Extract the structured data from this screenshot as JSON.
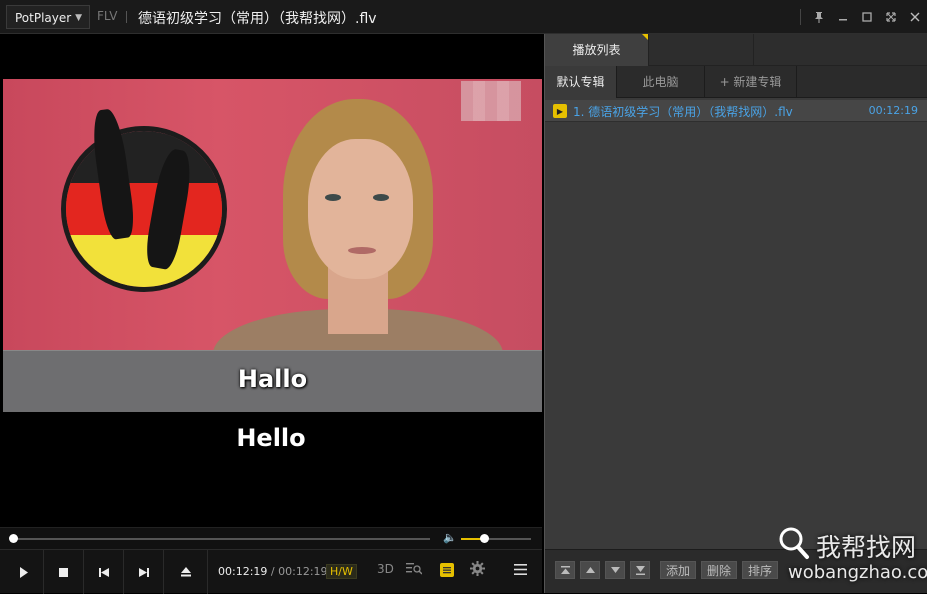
{
  "titlebar": {
    "app_name": "PotPlayer",
    "format": "FLV",
    "file_title": "德语初级学习（常用）（我帮找网）.flv"
  },
  "video": {
    "subtitle_primary": "Hallo",
    "subtitle_secondary": "Hello",
    "seek_fraction": 0.0,
    "volume_fraction": 0.34
  },
  "controls": {
    "time_current": "00:12:19",
    "time_separator": "/",
    "time_total": "00:12:19",
    "aspect_label": "H/W",
    "three_d_label": "3D"
  },
  "playlist": {
    "main_tab": "播放列表",
    "subtabs": [
      "默认专辑",
      "此电脑",
      "+ 新建专辑"
    ],
    "items": [
      {
        "name": "1. 德语初级学习（常用）（我帮找网）.flv",
        "duration": "00:12:19"
      }
    ],
    "buttons": [
      "添加",
      "删除",
      "排序"
    ]
  },
  "watermark": {
    "chinese": "我帮找网",
    "url": "wobangzhao.com"
  },
  "colors": {
    "accent": "#e6c000",
    "link": "#4aa3e6"
  }
}
